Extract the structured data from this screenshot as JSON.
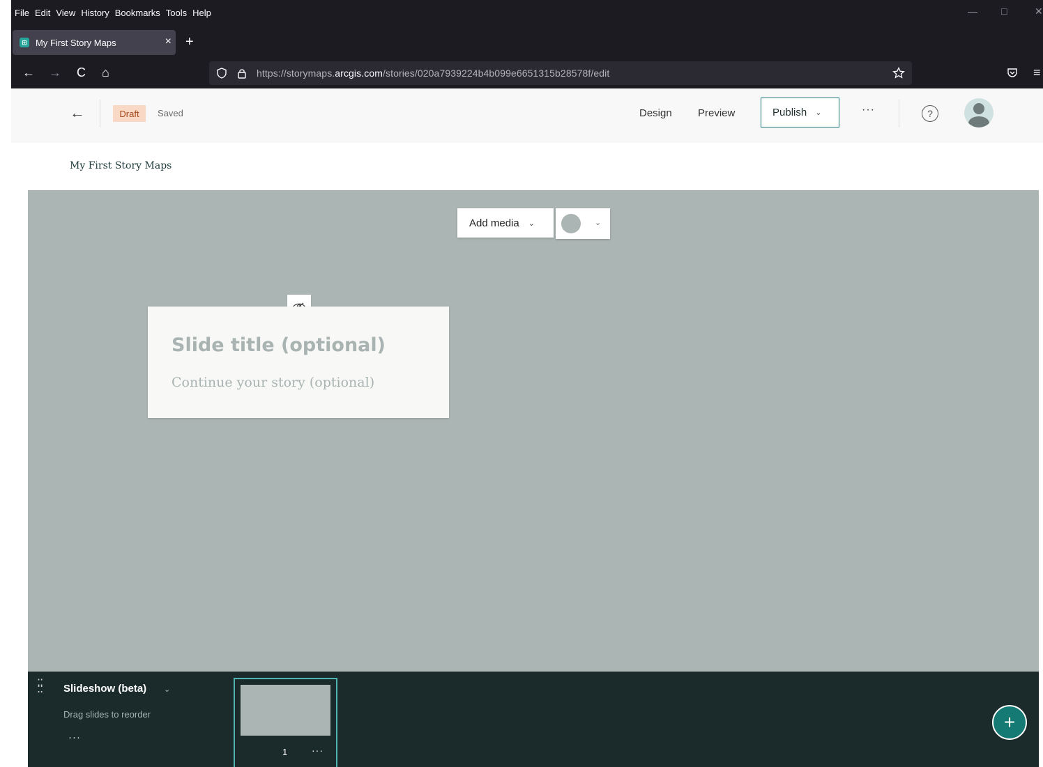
{
  "browser": {
    "menu": [
      "File",
      "Edit",
      "View",
      "History",
      "Bookmarks",
      "Tools",
      "Help"
    ],
    "tab": {
      "title": "My First Story Maps",
      "close": "×"
    },
    "new_tab": "+",
    "nav": {
      "back": "←",
      "forward": "→",
      "reload": "C",
      "home": "⌂"
    },
    "url": {
      "prefix": "https://storymaps.",
      "domain": "arcgis.com",
      "path": "/stories/020a7939224b4b099e6651315b28578f/edit"
    },
    "window": {
      "minimize": "—",
      "maximize": "□",
      "close": "✕"
    },
    "menu_glyph": "≡"
  },
  "header": {
    "back": "←",
    "status_badge": "Draft",
    "save_status": "Saved",
    "design": "Design",
    "preview": "Preview",
    "publish": "Publish",
    "more": "···",
    "help": "?"
  },
  "story": {
    "title": "My First Story Maps"
  },
  "canvas": {
    "add_media": "Add media",
    "slide_title_placeholder": "Slide title (optional)",
    "slide_body_placeholder": "Continue your story (optional)"
  },
  "slideshow": {
    "title": "Slideshow (beta)",
    "subtitle": "Drag slides to reorder",
    "more": "···",
    "slides": [
      {
        "number": "1",
        "more": "···"
      }
    ],
    "add": "+"
  },
  "colors": {
    "chrome_bg": "#1c1b22",
    "canvas_bg": "#abb5b3",
    "accent": "#157a74",
    "slidebar_bg": "#1b2a2a",
    "draft_badge_bg": "#f9d9c6"
  }
}
